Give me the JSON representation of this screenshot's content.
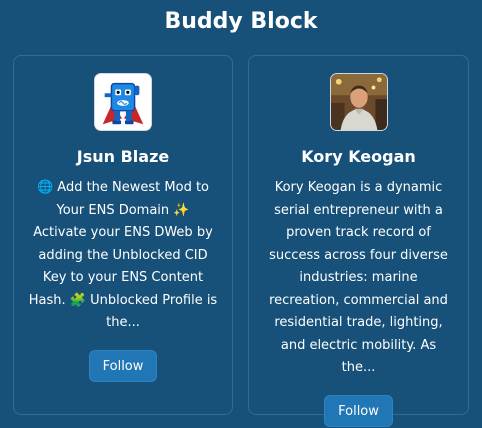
{
  "header": {
    "title": "Buddy Block"
  },
  "cards": [
    {
      "name": "Jsun Blaze",
      "bio": "🌐 Add the Newest Mod to Your ENS Domain ✨ Activate your ENS DWeb by adding the Unblocked CID Key to your ENS Content Hash. 🧩 Unblocked Profile is the...",
      "follow_label": "Follow",
      "avatar_icon": "robot-hero-icon"
    },
    {
      "name": "Kory Keogan",
      "bio": "Kory Keogan is a dynamic serial entrepreneur with a proven track record of success across four diverse industries: marine recreation, commercial and residential trade, lighting, and electric mobility. As the...",
      "follow_label": "Follow",
      "avatar_icon": "profile-photo-icon"
    }
  ],
  "colors": {
    "background": "#175179",
    "card_border": "#2d6d98",
    "button": "#2176b5",
    "text": "#ffffff"
  }
}
